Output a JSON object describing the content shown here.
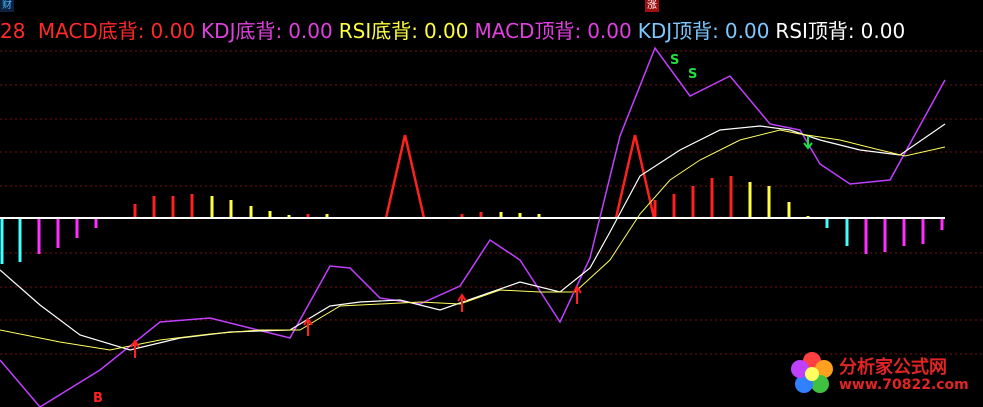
{
  "header": {
    "prefix": "28",
    "items": [
      {
        "label": "MACD底背:",
        "value": "0.00",
        "label_color": "#ff2a2a",
        "value_color": "#ff2a2a"
      },
      {
        "label": "KDJ底背:",
        "value": "0.00",
        "label_color": "#e040e0",
        "value_color": "#e040e0"
      },
      {
        "label": "RSI底背:",
        "value": "0.00",
        "label_color": "#ffff40",
        "value_color": "#ffff40"
      },
      {
        "label": "MACD顶背:",
        "value": "0.00",
        "label_color": "#e040e0",
        "value_color": "#e040e0"
      },
      {
        "label": "KDJ顶背:",
        "value": "0.00",
        "label_color": "#7ec8ff",
        "value_color": "#7ec8ff"
      },
      {
        "label": "RSI顶背:",
        "value": "0.00",
        "label_color": "#ffffff",
        "value_color": "#ffffff"
      }
    ]
  },
  "top_tags": {
    "left": "财",
    "right": "涨"
  },
  "markers": {
    "sell": "S",
    "buy": "B"
  },
  "logo": {
    "text": "分析家公式网",
    "url": "www.70822.com"
  },
  "colors": {
    "background": "#000000",
    "grid": "#7a1010",
    "zero_line": "#ffffff",
    "bar_red": "#ff2020",
    "bar_yellow": "#ffff40",
    "bar_cyan": "#40ffff",
    "bar_magenta": "#ff30ff",
    "k_line": "#c040ff",
    "d_line": "#ffffff",
    "j_line": "#ffff60",
    "sell_mark": "#20e040",
    "buy_mark": "#ff2020"
  }
}
